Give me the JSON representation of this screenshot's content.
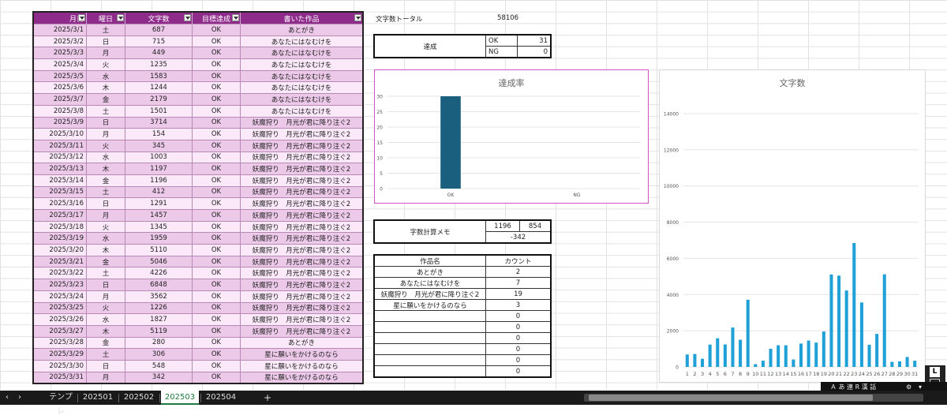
{
  "log_table": {
    "headers": [
      "月日",
      "曜日",
      "文字数",
      "目標達成",
      "書いた作品"
    ],
    "rows": [
      [
        "2025/3/1",
        "土",
        "687",
        "OK",
        "あとがき"
      ],
      [
        "2025/3/2",
        "日",
        "715",
        "OK",
        "あなたにはなむけを"
      ],
      [
        "2025/3/3",
        "月",
        "449",
        "OK",
        "あなたにはなむけを"
      ],
      [
        "2025/3/4",
        "火",
        "1235",
        "OK",
        "あなたにはなむけを"
      ],
      [
        "2025/3/5",
        "水",
        "1583",
        "OK",
        "あなたにはなむけを"
      ],
      [
        "2025/3/6",
        "木",
        "1244",
        "OK",
        "あなたにはなむけを"
      ],
      [
        "2025/3/7",
        "金",
        "2179",
        "OK",
        "あなたにはなむけを"
      ],
      [
        "2025/3/8",
        "土",
        "1501",
        "OK",
        "あなたにはなむけを"
      ],
      [
        "2025/3/9",
        "日",
        "3714",
        "OK",
        "妖魔狩り　月光が君に降り注ぐ2"
      ],
      [
        "2025/3/10",
        "月",
        "154",
        "OK",
        "妖魔狩り　月光が君に降り注ぐ2"
      ],
      [
        "2025/3/11",
        "火",
        "345",
        "OK",
        "妖魔狩り　月光が君に降り注ぐ2"
      ],
      [
        "2025/3/12",
        "水",
        "1003",
        "OK",
        "妖魔狩り　月光が君に降り注ぐ2"
      ],
      [
        "2025/3/13",
        "木",
        "1197",
        "OK",
        "妖魔狩り　月光が君に降り注ぐ2"
      ],
      [
        "2025/3/14",
        "金",
        "1196",
        "OK",
        "妖魔狩り　月光が君に降り注ぐ2"
      ],
      [
        "2025/3/15",
        "土",
        "412",
        "OK",
        "妖魔狩り　月光が君に降り注ぐ2"
      ],
      [
        "2025/3/16",
        "日",
        "1291",
        "OK",
        "妖魔狩り　月光が君に降り注ぐ2"
      ],
      [
        "2025/3/17",
        "月",
        "1457",
        "OK",
        "妖魔狩り　月光が君に降り注ぐ2"
      ],
      [
        "2025/3/18",
        "火",
        "1345",
        "OK",
        "妖魔狩り　月光が君に降り注ぐ2"
      ],
      [
        "2025/3/19",
        "水",
        "1959",
        "OK",
        "妖魔狩り　月光が君に降り注ぐ2"
      ],
      [
        "2025/3/20",
        "木",
        "5110",
        "OK",
        "妖魔狩り　月光が君に降り注ぐ2"
      ],
      [
        "2025/3/21",
        "金",
        "5046",
        "OK",
        "妖魔狩り　月光が君に降り注ぐ2"
      ],
      [
        "2025/3/22",
        "土",
        "4226",
        "OK",
        "妖魔狩り　月光が君に降り注ぐ2"
      ],
      [
        "2025/3/23",
        "日",
        "6848",
        "OK",
        "妖魔狩り　月光が君に降り注ぐ2"
      ],
      [
        "2025/3/24",
        "月",
        "3562",
        "OK",
        "妖魔狩り　月光が君に降り注ぐ2"
      ],
      [
        "2025/3/25",
        "火",
        "1226",
        "OK",
        "妖魔狩り　月光が君に降り注ぐ2"
      ],
      [
        "2025/3/26",
        "水",
        "1827",
        "OK",
        "妖魔狩り　月光が君に降り注ぐ2"
      ],
      [
        "2025/3/27",
        "木",
        "5119",
        "OK",
        "妖魔狩り　月光が君に降り注ぐ2"
      ],
      [
        "2025/3/28",
        "金",
        "280",
        "OK",
        "あとがき"
      ],
      [
        "2025/3/29",
        "土",
        "306",
        "OK",
        "星に願いをかけるのなら"
      ],
      [
        "2025/3/30",
        "日",
        "548",
        "OK",
        "星に願いをかけるのなら"
      ],
      [
        "2025/3/31",
        "月",
        "342",
        "OK",
        "星に願いをかけるのなら"
      ]
    ]
  },
  "total": {
    "label": "文字数トータル",
    "value": "58106"
  },
  "achievement": {
    "label": "達成",
    "ok_label": "OK",
    "ok_value": "31",
    "ng_label": "NG",
    "ng_value": "0"
  },
  "memo": {
    "label": "字数計算メモ",
    "a": "1196",
    "b": "854",
    "diff": "-342"
  },
  "works": {
    "headers": [
      "作品名",
      "カウント"
    ],
    "rows": [
      [
        "あとがき",
        "2"
      ],
      [
        "あなたにはなむけを",
        "7"
      ],
      [
        "妖魔狩り　月光が君に降り注ぐ2",
        "19"
      ],
      [
        "星に願いをかけるのなら",
        "3"
      ],
      [
        "",
        "0"
      ],
      [
        "",
        "0"
      ],
      [
        "",
        "0"
      ],
      [
        "",
        "0"
      ],
      [
        "",
        "0"
      ],
      [
        "",
        "0"
      ]
    ]
  },
  "chart_data": [
    {
      "type": "bar",
      "title": "達成率",
      "categories": [
        "OK",
        "NG"
      ],
      "values": [
        31,
        0
      ],
      "ylim": [
        0,
        30
      ],
      "yticks": [
        0,
        5,
        10,
        15,
        20,
        25,
        30
      ],
      "color": "#1b5f7f",
      "grid": true
    },
    {
      "type": "bar",
      "title": "文字数",
      "categories": [
        "1",
        "2",
        "3",
        "4",
        "5",
        "6",
        "7",
        "8",
        "9",
        "10",
        "11",
        "12",
        "13",
        "14",
        "15",
        "16",
        "17",
        "18",
        "19",
        "20",
        "21",
        "22",
        "23",
        "24",
        "25",
        "26",
        "27",
        "28",
        "29",
        "30",
        "31"
      ],
      "values": [
        687,
        715,
        449,
        1235,
        1583,
        1244,
        2179,
        1501,
        3714,
        154,
        345,
        1003,
        1197,
        1196,
        412,
        1291,
        1457,
        1345,
        1959,
        5110,
        5046,
        4226,
        6848,
        3562,
        1226,
        1827,
        5119,
        280,
        306,
        548,
        342
      ],
      "ylim": [
        0,
        14000
      ],
      "yticks": [
        0,
        2000,
        4000,
        6000,
        8000,
        10000,
        12000,
        14000
      ],
      "color": "#1fa0d6",
      "grid": true
    }
  ],
  "sheet_tabs": {
    "labels": [
      "テンプレ",
      "202501",
      "202502",
      "202503",
      "202504"
    ],
    "active": "202503",
    "add": "+"
  },
  "ime": {
    "text": "Ａ あ 連 R 漢 話"
  }
}
